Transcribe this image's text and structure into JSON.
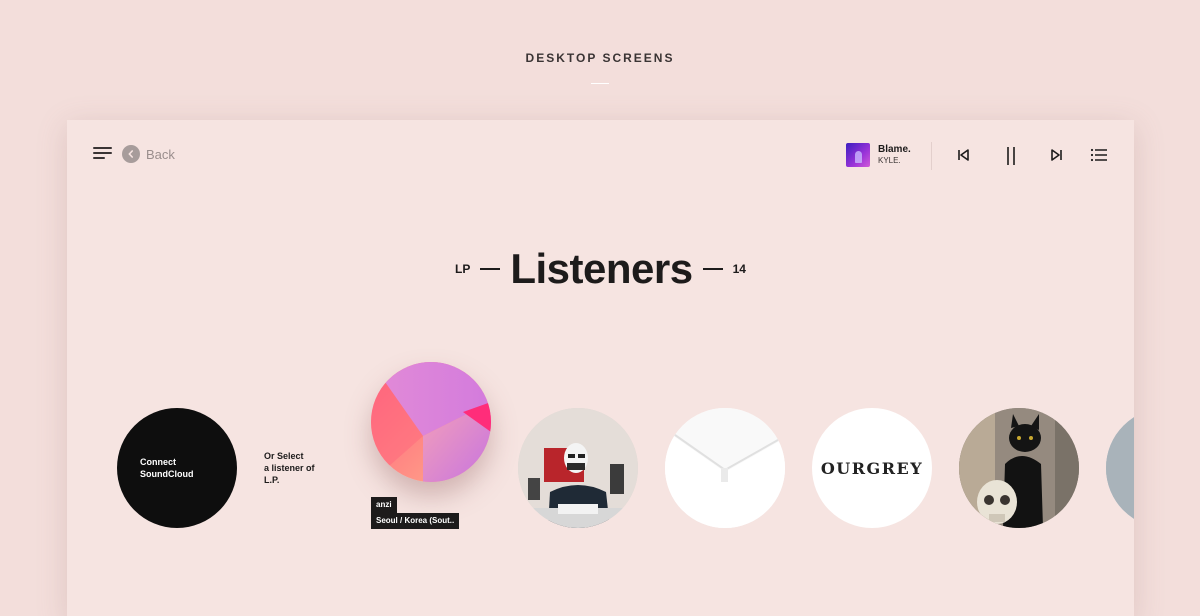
{
  "page": {
    "section_title": "DESKTOP SCREENS"
  },
  "header": {
    "back_label": "Back",
    "now_playing": {
      "title": "Blame.",
      "artist": "KYLE."
    },
    "controls": [
      "previous-icon",
      "pause-icon",
      "next-icon",
      "playlist-icon"
    ]
  },
  "title": {
    "prefix": "LP",
    "main": "Listeners",
    "count": "14"
  },
  "connect": {
    "label_line1": "Connect",
    "label_line2": "SoundCloud"
  },
  "or_select": {
    "line1": "Or Select",
    "line2": "a listener of",
    "line3": "L.P."
  },
  "active_listener": {
    "name": "anzi",
    "location": "Seoul / Korea (Sout.."
  },
  "listeners": [
    {
      "label": ""
    },
    {
      "label": ""
    },
    {
      "label": "OURGREY"
    },
    {
      "label": ""
    },
    {
      "label": ""
    }
  ],
  "colors": {
    "background": "#f3dedb",
    "window": "#f6e4e1",
    "text": "#1d1b1b",
    "accent_muted": "#a79c9b"
  }
}
